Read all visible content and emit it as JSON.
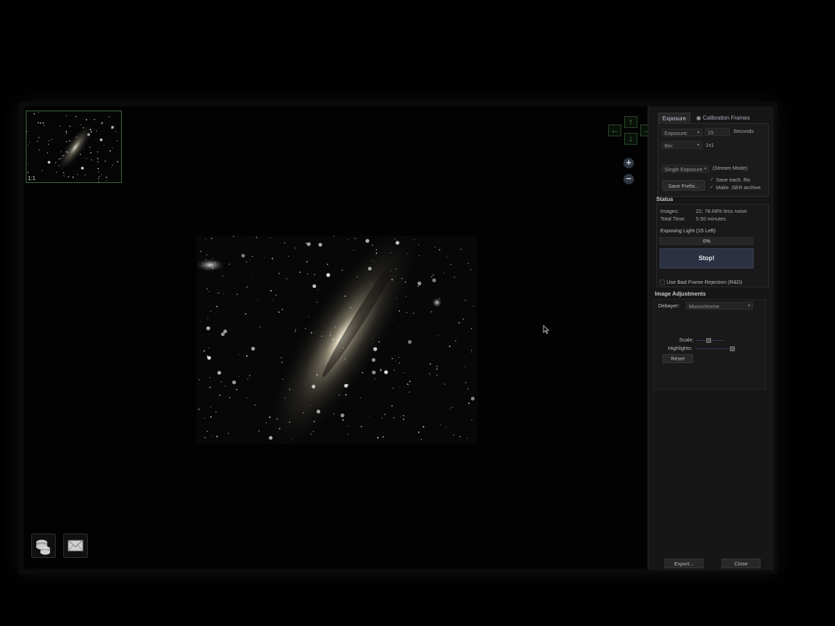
{
  "thumbnail": {
    "zoom_label": "1:1"
  },
  "tabs": [
    {
      "label": "Exposure"
    },
    {
      "label": "Calibration Frames"
    }
  ],
  "exposure": {
    "exposure_label": "Exposure:",
    "exposure_value": "15",
    "exposure_unit": "Seconds",
    "bin_label": "Bin:",
    "bin_value": "1x1",
    "mode_value": "Single Exposure",
    "stream_mode": "(Stream Mode)",
    "save_prefix_label": "Save Prefix...",
    "save_fits_label": "Save each .fits",
    "make_ser_label": "Make .SER archive"
  },
  "status": {
    "heading": "Status",
    "images_label": "Images:",
    "images_value": "22, 78.68% less noise",
    "total_time_label": "Total Time:",
    "total_time_value": "5.50 minutes",
    "exposing_label": "Exposing Light (15 Left)",
    "progress_text": "0%",
    "progress_value": 0,
    "stop_label": "Stop!",
    "bad_frame_label": "Use Bad Frame Rejection (R&D)"
  },
  "adjustments": {
    "heading": "Image Adjustments",
    "debayer_label": "Debayer:",
    "debayer_value": "Monochrome",
    "scale_label": "Scale:",
    "scale_value": 0.45,
    "highlights_label": "Highlights:",
    "highlights_value": 0.9,
    "reset_label": "Reset"
  },
  "footer": {
    "export_label": "Export...",
    "close_label": "Close"
  },
  "colors": {
    "accent": "#3a5a8a",
    "nav_green": "#4d9a4d"
  },
  "icons": {
    "nav_left": "arrow-left-icon",
    "nav_right": "arrow-right-icon",
    "nav_up": "arrow-up-icon",
    "nav_down": "arrow-down-icon",
    "zoom_in": "zoom-in-icon",
    "zoom_out": "zoom-out-icon",
    "tool_stack": "stack-icon",
    "tool_mail": "mail-icon"
  }
}
